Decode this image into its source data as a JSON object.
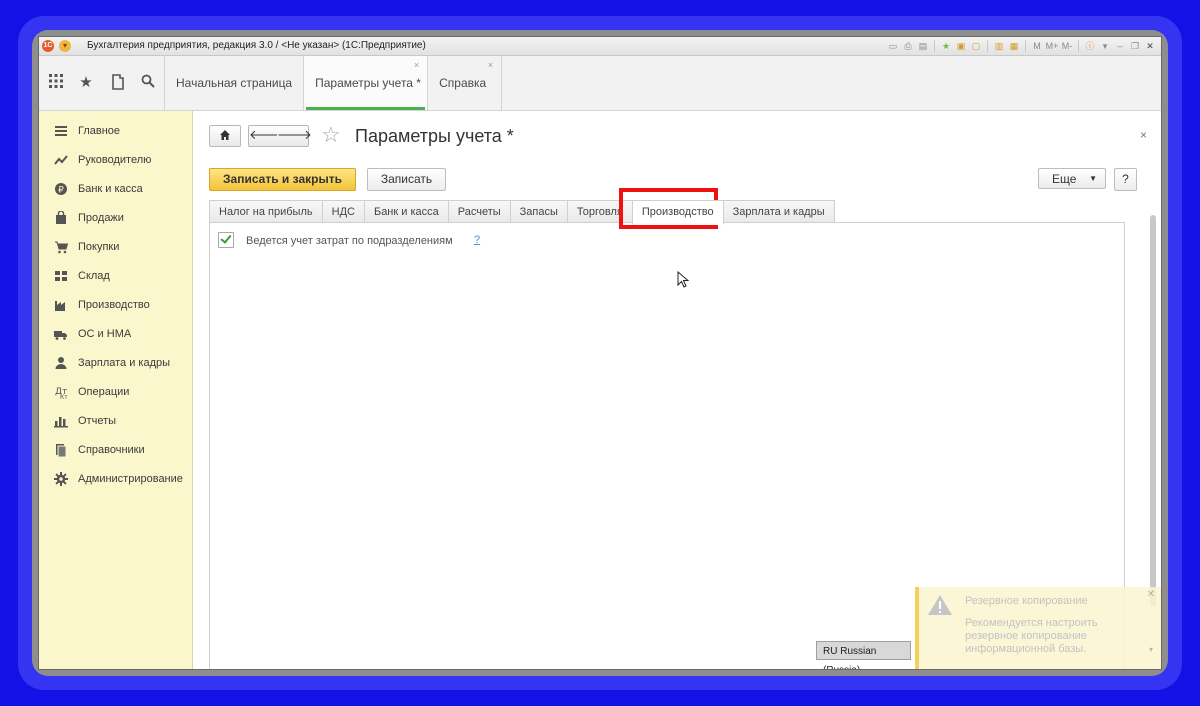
{
  "titlebar": {
    "title": "Бухгалтерия предприятия, редакция 3.0 / <Не указан>  (1С:Предприятие)",
    "logo": "1C",
    "tools": [
      "M",
      "M+",
      "M-"
    ]
  },
  "open_tabs": [
    {
      "label": "Начальная страница",
      "closable": false,
      "active": false
    },
    {
      "label": "Параметры учета *",
      "closable": true,
      "active": true
    },
    {
      "label": "Справка",
      "closable": true,
      "active": false
    }
  ],
  "close_glyph": "×",
  "sidebar": {
    "items": [
      {
        "label": "Главное",
        "icon": "list-icon"
      },
      {
        "label": "Руководителю",
        "icon": "trend-icon"
      },
      {
        "label": "Банк и касса",
        "icon": "coin-icon"
      },
      {
        "label": "Продажи",
        "icon": "bag-icon"
      },
      {
        "label": "Покупки",
        "icon": "cart-icon"
      },
      {
        "label": "Склад",
        "icon": "warehouse-icon"
      },
      {
        "label": "Производство",
        "icon": "factory-icon"
      },
      {
        "label": "ОС и НМА",
        "icon": "truck-icon"
      },
      {
        "label": "Зарплата и кадры",
        "icon": "person-icon"
      },
      {
        "label": "Операции",
        "icon": "operations-icon"
      },
      {
        "label": "Отчеты",
        "icon": "bar-chart-icon"
      },
      {
        "label": "Справочники",
        "icon": "book-icon"
      },
      {
        "label": "Администрирование",
        "icon": "gear-icon"
      }
    ]
  },
  "form": {
    "title": "Параметры учета *",
    "save_close_label": "Записать и закрыть",
    "save_label": "Записать",
    "more_label": "Еще",
    "help_label": "?",
    "close_glyph": "×"
  },
  "section_tabs": [
    {
      "label": "Налог на прибыль",
      "active": false
    },
    {
      "label": "НДС",
      "active": false
    },
    {
      "label": "Банк и касса",
      "active": false
    },
    {
      "label": "Расчеты",
      "active": false
    },
    {
      "label": "Запасы",
      "active": false
    },
    {
      "label": "Торговля",
      "active": false
    },
    {
      "label": "Производство",
      "active": true
    },
    {
      "label": "Зарплата и кадры",
      "active": false
    }
  ],
  "production_tab": {
    "checkbox_label": "Ведется учет затрат по подразделениям",
    "checkbox_checked": true,
    "help_link": "?"
  },
  "statusbar": {
    "language": "RU Russian (Russia)"
  },
  "notification": {
    "title": "Резервное копирование",
    "text": "Рекомендуется настроить резервное копирование информационной базы."
  },
  "colors": {
    "highlight": "#ee1111",
    "sidebar_bg": "#fbf7cc",
    "primary_button": "#f3c43a",
    "active_tab_underline": "#4cae4c"
  }
}
